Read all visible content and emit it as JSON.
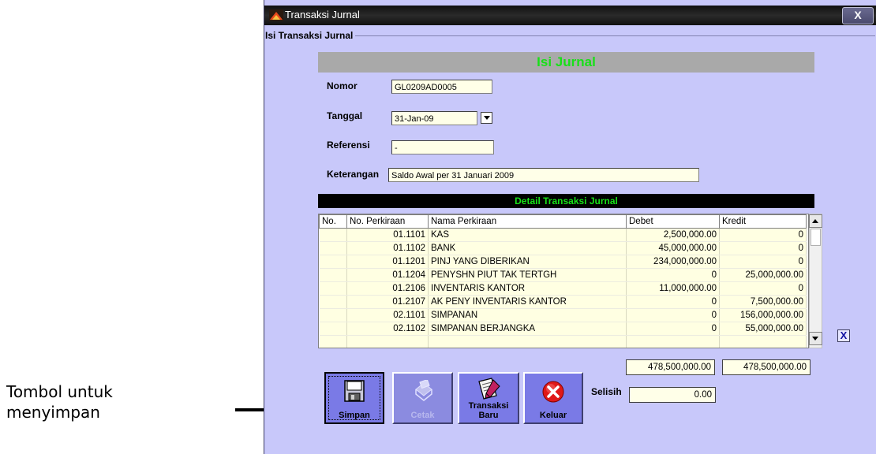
{
  "annotation": {
    "line1": "Tombol untuk",
    "line2": "menyimpan"
  },
  "window": {
    "title": "Transaksi Jurnal",
    "close_label": "X",
    "group_label": "Isi Transaksi Jurnal"
  },
  "form": {
    "header": "Isi Jurnal",
    "nomor_label": "Nomor",
    "nomor_value": "GL0209AD0005",
    "tanggal_label": "Tanggal",
    "tanggal_value": "31-Jan-09",
    "referensi_label": "Referensi",
    "referensi_value": "-",
    "keterangan_label": "Keterangan",
    "keterangan_value": "Saldo Awal per 31 Januari 2009"
  },
  "detail": {
    "header": "Detail Transaksi Jurnal",
    "columns": [
      "No.",
      "No. Perkiraan",
      "Nama Perkiraan",
      "Debet",
      "Kredit"
    ],
    "rows": [
      [
        "",
        "01.1101",
        "KAS",
        "2,500,000.00",
        "0"
      ],
      [
        "",
        "01.1102",
        "BANK",
        "45,000,000.00",
        "0"
      ],
      [
        "",
        "01.1201",
        "PINJ YANG DIBERIKAN",
        "234,000,000.00",
        "0"
      ],
      [
        "",
        "01.1204",
        "PENYSHN PIUT TAK TERTGH",
        "0",
        "25,000,000.00"
      ],
      [
        "",
        "01.2106",
        "INVENTARIS KANTOR",
        "11,000,000.00",
        "0"
      ],
      [
        "",
        "01.2107",
        "AK PENY INVENTARIS KANTOR",
        "0",
        "7,500,000.00"
      ],
      [
        "",
        "02.1101",
        "SIMPANAN",
        "0",
        "156,000,000.00"
      ],
      [
        "",
        "02.1102",
        "SIMPANAN BERJANGKA",
        "0",
        "55,000,000.00"
      ]
    ],
    "delete_label": "X",
    "total_debet": "478,500,000.00",
    "total_kredit": "478,500,000.00",
    "selisih_label": "Selisih",
    "selisih_value": "0.00"
  },
  "buttons": {
    "simpan": "Simpan",
    "cetak": "Cetak",
    "transaksi_baru_1": "Transaksi",
    "transaksi_baru_2": "Baru",
    "keluar": "Keluar"
  },
  "colors": {
    "window_bg": "#c8c8fa",
    "header_text": "#18e018",
    "button_bg": "#7a7ae6"
  }
}
